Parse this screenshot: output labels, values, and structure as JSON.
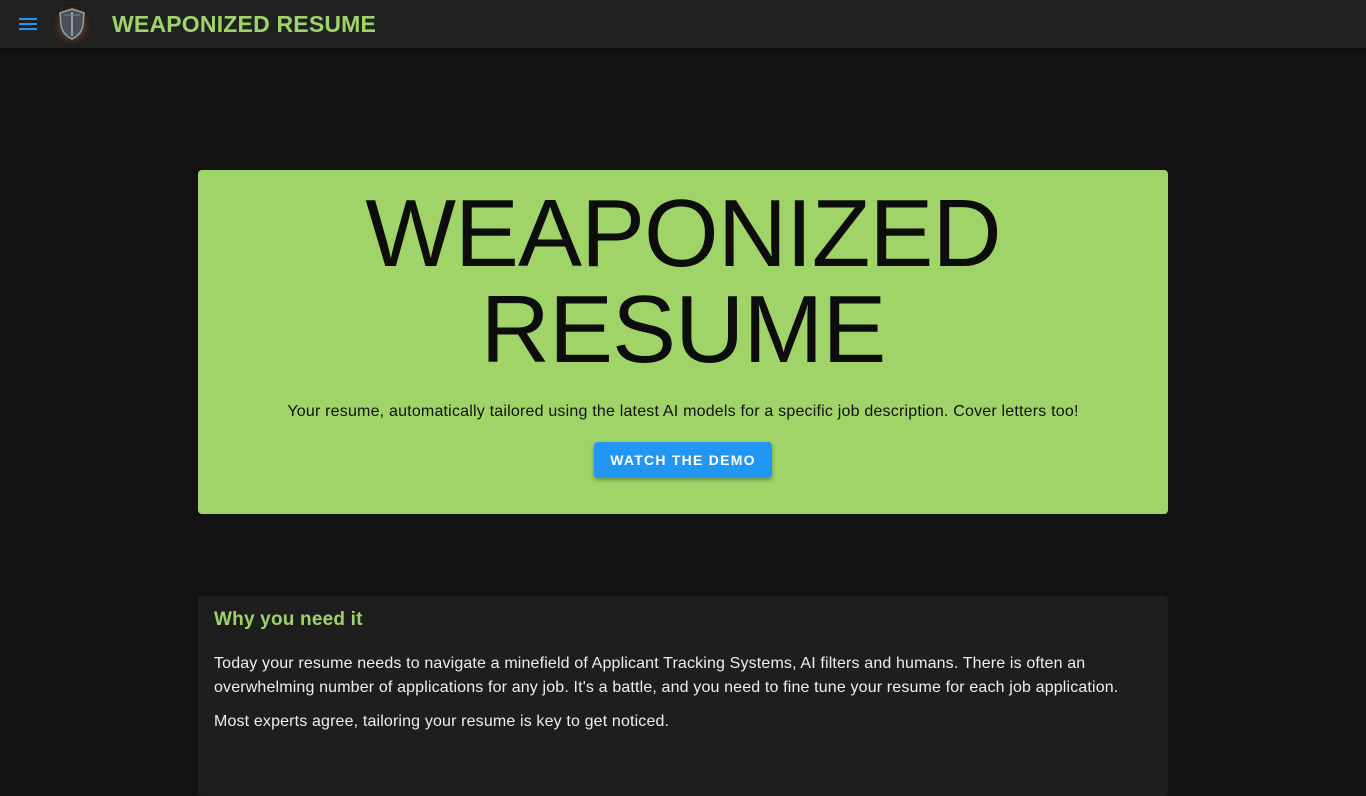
{
  "header": {
    "menu_icon": "menu-icon",
    "logo_icon": "shield-icon",
    "title": "WEAPONIZED RESUME"
  },
  "hero": {
    "title_line1": "WEAPONIZED",
    "title_line2": "RESUME",
    "subtitle": "Your resume, automatically tailored using the latest AI models for a specific job description. Cover letters too!",
    "cta_label": "WATCH THE DEMO"
  },
  "why": {
    "heading": "Why you need it",
    "paragraph1": "Today your resume needs to navigate a minefield of Applicant Tracking Systems, AI filters and humans. There is often an overwhelming number of applications for any job. It's a battle, and you need to fine tune your resume for each job application.",
    "paragraph2": "Most experts agree, tailoring your resume is key to get noticed."
  },
  "colors": {
    "accent_green": "#a0d468",
    "title_green": "#9ed36a",
    "button_blue": "#2196f3",
    "background": "#121212",
    "appbar": "#212121",
    "card": "#1e1e1e"
  }
}
